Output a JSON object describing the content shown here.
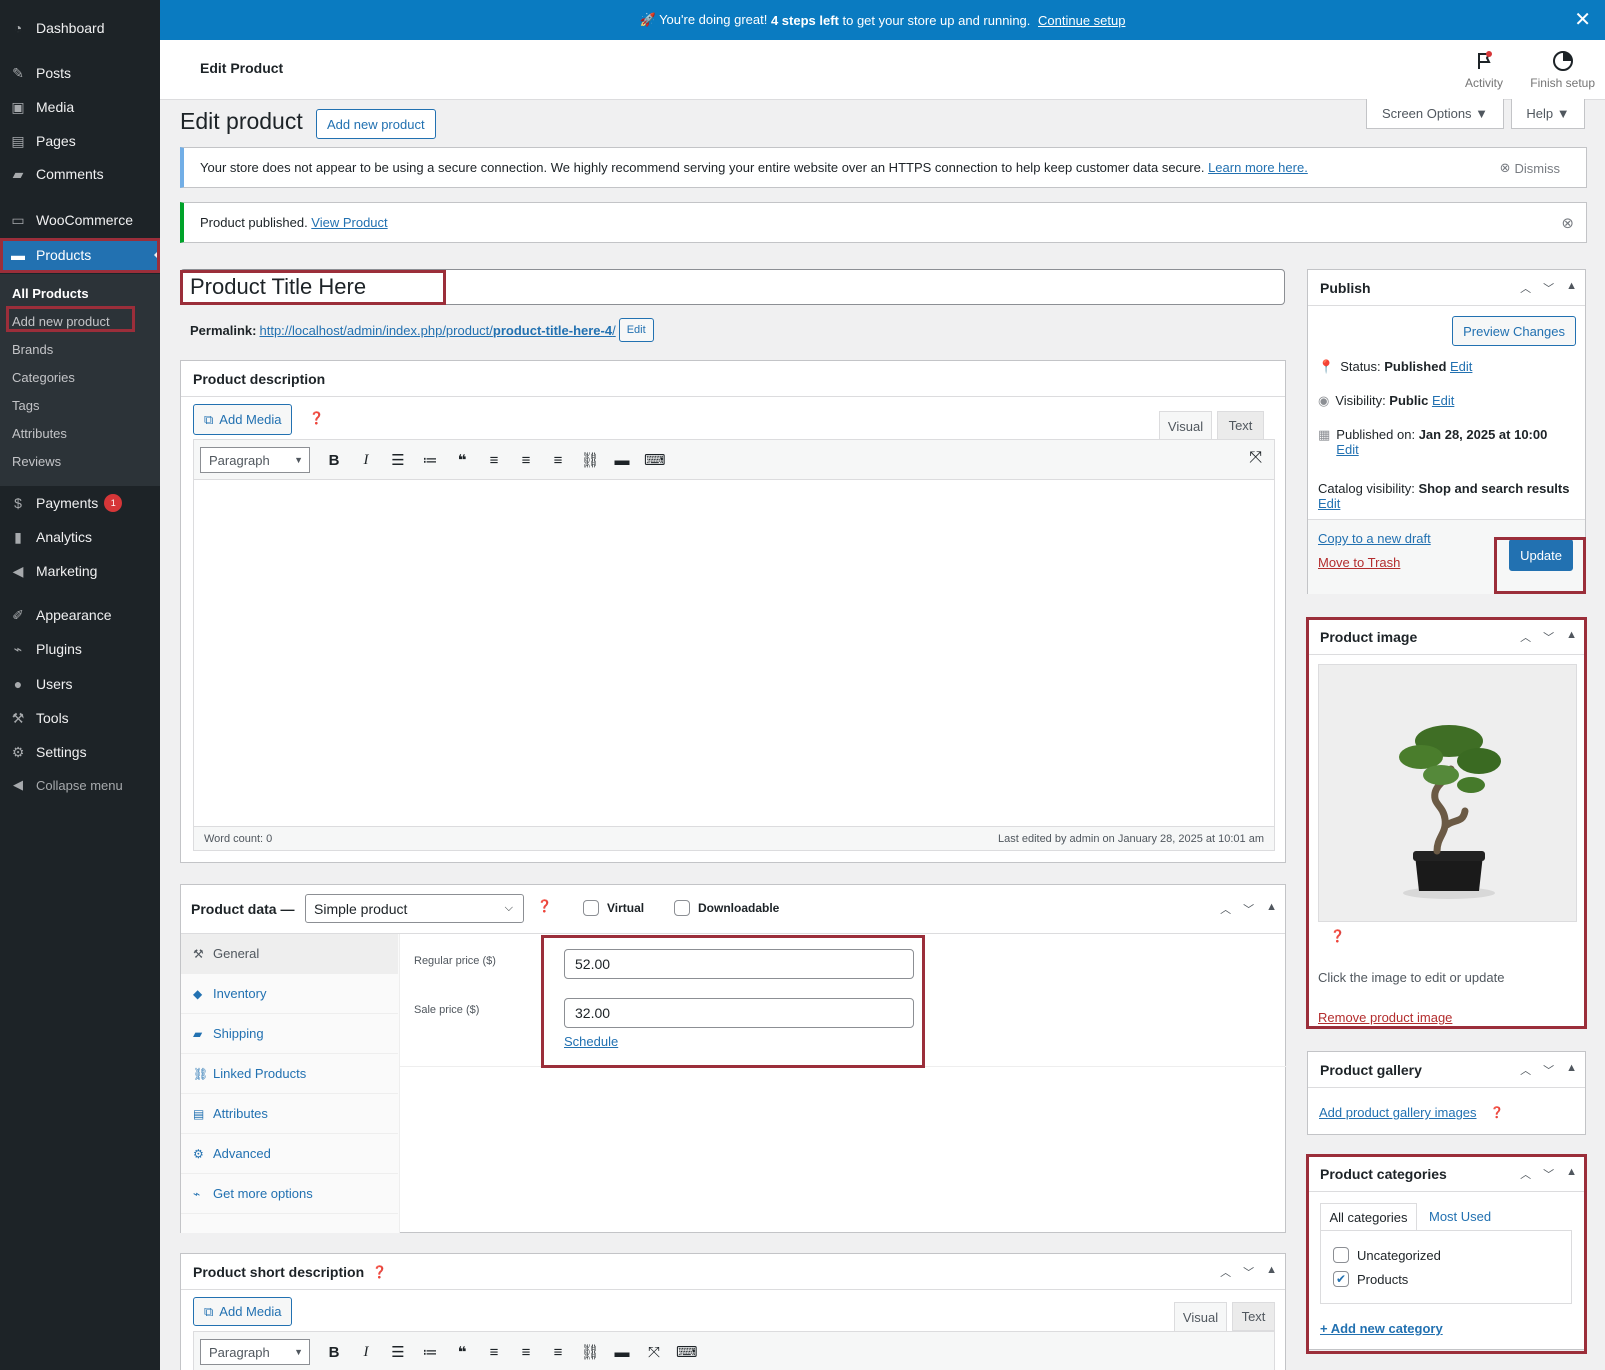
{
  "sidebar": {
    "items": [
      {
        "label": "Dashboard",
        "icon": "dashboard-icon"
      },
      {
        "label": "Posts",
        "icon": "pin-icon"
      },
      {
        "label": "Media",
        "icon": "media-icon"
      },
      {
        "label": "Pages",
        "icon": "page-icon"
      },
      {
        "label": "Comments",
        "icon": "comment-icon"
      },
      {
        "label": "WooCommerce",
        "icon": "woo-icon"
      },
      {
        "label": "Products",
        "icon": "archive-icon"
      },
      {
        "label": "Payments",
        "icon": "dollar-icon",
        "badge": "1"
      },
      {
        "label": "Analytics",
        "icon": "bar-chart-icon"
      },
      {
        "label": "Marketing",
        "icon": "megaphone-icon"
      },
      {
        "label": "Appearance",
        "icon": "brush-icon"
      },
      {
        "label": "Plugins",
        "icon": "plug-icon"
      },
      {
        "label": "Users",
        "icon": "user-icon"
      },
      {
        "label": "Tools",
        "icon": "wrench-icon"
      },
      {
        "label": "Settings",
        "icon": "settings-icon"
      },
      {
        "label": "Collapse menu",
        "icon": "collapse-icon"
      }
    ],
    "submenu": [
      "All Products",
      "Add new product",
      "Brands",
      "Categories",
      "Tags",
      "Attributes",
      "Reviews"
    ]
  },
  "banner": {
    "prefix": "🚀 You're doing great! ",
    "bold": "4 steps left",
    "middle": " to get your store up and running. ",
    "link": "Continue setup",
    "close": "✕"
  },
  "header": {
    "title": "Edit Product",
    "activity": "Activity",
    "finish": "Finish setup"
  },
  "page": {
    "title": "Edit product",
    "add_new": "Add new product",
    "screen_options": "Screen Options ▼",
    "help": "Help ▼"
  },
  "notices": {
    "ssl": "Your store does not appear to be using a secure connection. We highly recommend serving your entire website over an HTTPS connection to help keep customer data secure. ",
    "ssl_link": "Learn more here.",
    "dismiss": "Dismiss",
    "published": "Product published. ",
    "view_product": "View Product"
  },
  "title_field": {
    "value": "Product Title Here"
  },
  "permalink": {
    "label": "Permalink:",
    "base": "http://localhost/admin/index.php/product/",
    "slug": "product-title-here-4",
    "trail": "/",
    "edit": "Edit"
  },
  "description": {
    "title": "Product description",
    "add_media": "Add Media",
    "tab_visual": "Visual",
    "tab_text": "Text",
    "format": "Paragraph",
    "word_count": "Word count: 0",
    "last_edited": "Last edited by admin on January 28, 2025 at 10:01 am"
  },
  "product_data": {
    "title": "Product data —",
    "type": "Simple product",
    "virtual": "Virtual",
    "downloadable": "Downloadable",
    "tabs": [
      "General",
      "Inventory",
      "Shipping",
      "Linked Products",
      "Attributes",
      "Advanced",
      "Get more options"
    ],
    "regular_label": "Regular price ($)",
    "regular_value": "52.00",
    "sale_label": "Sale price ($)",
    "sale_value": "32.00",
    "schedule": "Schedule"
  },
  "short_description": {
    "title": "Product short description",
    "add_media": "Add Media",
    "tab_visual": "Visual",
    "tab_text": "Text",
    "format": "Paragraph"
  },
  "publish": {
    "title": "Publish",
    "preview": "Preview Changes",
    "status_label": "Status: ",
    "status": "Published",
    "visibility_label": "Visibility: ",
    "visibility": "Public",
    "published_label": "Published on: ",
    "published_on": "Jan 28, 2025 at 10:00",
    "catalog_label": "Catalog visibility: ",
    "catalog": "Shop and search results",
    "edit": "Edit",
    "copy_draft": "Copy to a new draft",
    "trash": "Move to Trash",
    "update": "Update"
  },
  "product_image": {
    "title": "Product image",
    "hint": "Click the image to edit or update",
    "remove": "Remove product image"
  },
  "gallery": {
    "title": "Product gallery",
    "add": "Add product gallery images"
  },
  "categories": {
    "title": "Product categories",
    "tab_all": "All categories",
    "tab_used": "Most Used",
    "items": [
      {
        "label": "Uncategorized",
        "checked": false
      },
      {
        "label": "Products",
        "checked": true
      }
    ],
    "add": "+ Add new category"
  }
}
